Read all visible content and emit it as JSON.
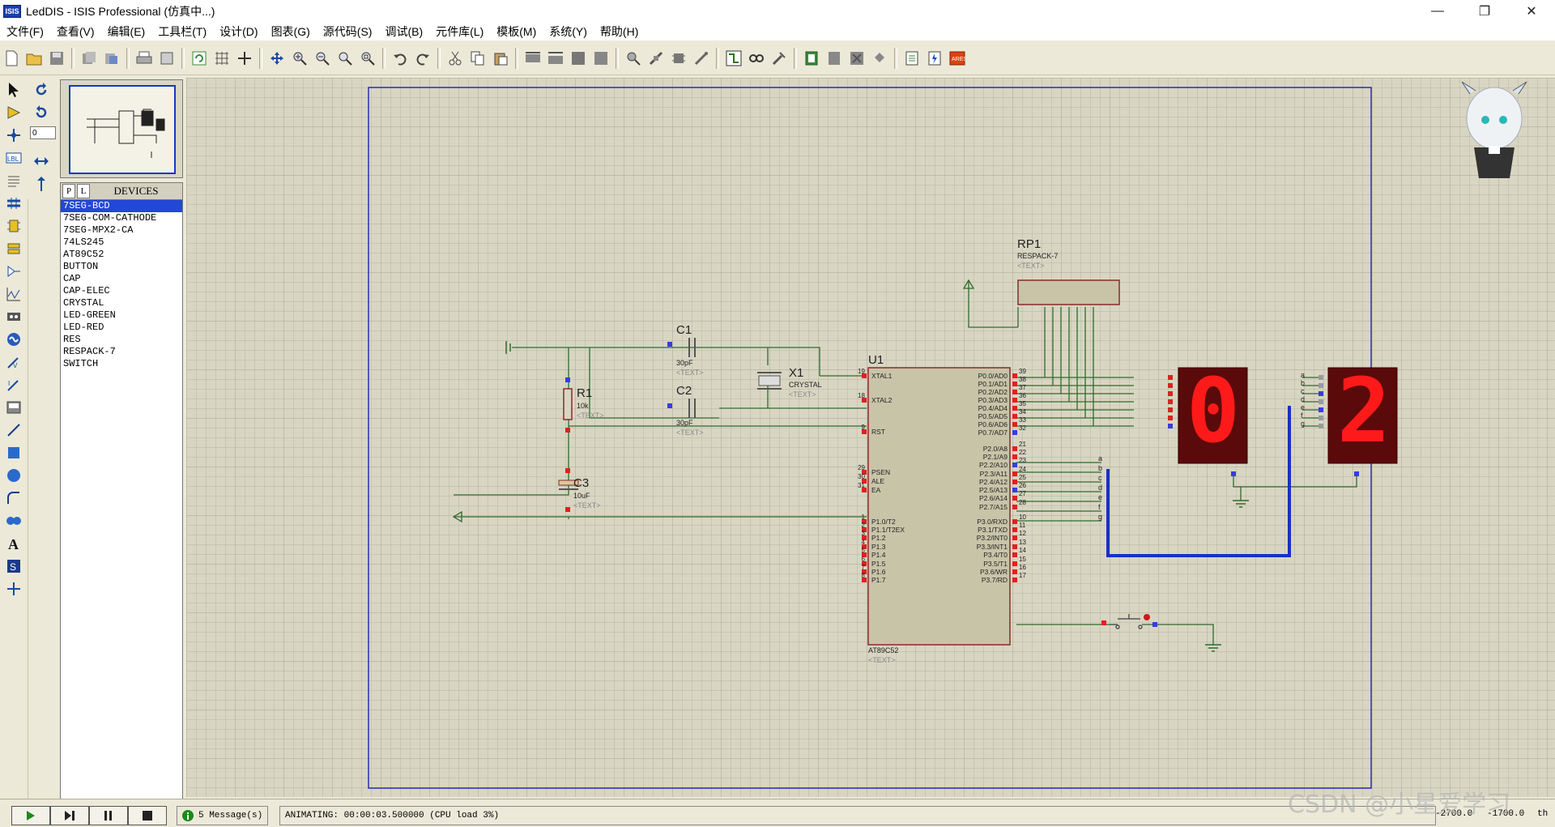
{
  "window": {
    "title": "LedDIS - ISIS Professional (仿真中...)",
    "app_icon": "ISIS"
  },
  "menu": [
    {
      "label": "文件(F)"
    },
    {
      "label": "查看(V)"
    },
    {
      "label": "编辑(E)"
    },
    {
      "label": "工具栏(T)"
    },
    {
      "label": "设计(D)"
    },
    {
      "label": "图表(G)"
    },
    {
      "label": "源代码(S)"
    },
    {
      "label": "调试(B)"
    },
    {
      "label": "元件库(L)"
    },
    {
      "label": "模板(M)"
    },
    {
      "label": "系统(Y)"
    },
    {
      "label": "帮助(H)"
    }
  ],
  "rotation_field": {
    "value": "0"
  },
  "devices": {
    "tab_p": "P",
    "tab_l": "L",
    "header": "DEVICES",
    "items": [
      {
        "label": "7SEG-BCD",
        "selected": true
      },
      {
        "label": "7SEG-COM-CATHODE"
      },
      {
        "label": "7SEG-MPX2-CA"
      },
      {
        "label": "74LS245"
      },
      {
        "label": "AT89C52"
      },
      {
        "label": "BUTTON"
      },
      {
        "label": "CAP"
      },
      {
        "label": "CAP-ELEC"
      },
      {
        "label": "CRYSTAL"
      },
      {
        "label": "LED-GREEN"
      },
      {
        "label": "LED-RED"
      },
      {
        "label": "RES"
      },
      {
        "label": "RESPACK-7"
      },
      {
        "label": "SWITCH"
      }
    ]
  },
  "schematic": {
    "rp1": {
      "ref": "RP1",
      "part": "RESPACK-7",
      "text": "<TEXT>"
    },
    "c1": {
      "ref": "C1",
      "value": "30pF",
      "text": "<TEXT>"
    },
    "c2": {
      "ref": "C2",
      "value": "30pF",
      "text": "<TEXT>"
    },
    "x1": {
      "ref": "X1",
      "part": "CRYSTAL",
      "text": "<TEXT>"
    },
    "r1": {
      "ref": "R1",
      "value": "10k",
      "text": "<TEXT>"
    },
    "c3": {
      "ref": "C3",
      "value": "10uF",
      "text": "<TEXT>"
    },
    "u1": {
      "ref": "U1",
      "part": "AT89C52",
      "text": "<TEXT>",
      "left_pins": [
        {
          "num": "19",
          "name": "XTAL1"
        },
        {
          "num": "18",
          "name": "XTAL2"
        },
        {
          "num": "9",
          "name": "RST"
        },
        {
          "num": "29",
          "name": "PSEN"
        },
        {
          "num": "30",
          "name": "ALE"
        },
        {
          "num": "31",
          "name": "EA"
        },
        {
          "num": "1",
          "name": "P1.0/T2"
        },
        {
          "num": "2",
          "name": "P1.1/T2EX"
        },
        {
          "num": "3",
          "name": "P1.2"
        },
        {
          "num": "4",
          "name": "P1.3"
        },
        {
          "num": "5",
          "name": "P1.4"
        },
        {
          "num": "6",
          "name": "P1.5"
        },
        {
          "num": "7",
          "name": "P1.6"
        },
        {
          "num": "8",
          "name": "P1.7"
        }
      ],
      "right_pins": [
        {
          "num": "39",
          "name": "P0.0/AD0"
        },
        {
          "num": "38",
          "name": "P0.1/AD1"
        },
        {
          "num": "37",
          "name": "P0.2/AD2"
        },
        {
          "num": "36",
          "name": "P0.3/AD3"
        },
        {
          "num": "35",
          "name": "P0.4/AD4"
        },
        {
          "num": "34",
          "name": "P0.5/AD5"
        },
        {
          "num": "33",
          "name": "P0.6/AD6"
        },
        {
          "num": "32",
          "name": "P0.7/AD7"
        },
        {
          "num": "21",
          "name": "P2.0/A8"
        },
        {
          "num": "22",
          "name": "P2.1/A9"
        },
        {
          "num": "23",
          "name": "P2.2/A10"
        },
        {
          "num": "24",
          "name": "P2.3/A11"
        },
        {
          "num": "25",
          "name": "P2.4/A12"
        },
        {
          "num": "26",
          "name": "P2.5/A13"
        },
        {
          "num": "27",
          "name": "P2.6/A14"
        },
        {
          "num": "28",
          "name": "P2.7/A15"
        },
        {
          "num": "10",
          "name": "P3.0/RXD"
        },
        {
          "num": "11",
          "name": "P3.1/TXD"
        },
        {
          "num": "12",
          "name": "P3.2/INT0"
        },
        {
          "num": "13",
          "name": "P3.3/INT1"
        },
        {
          "num": "14",
          "name": "P3.4/T0"
        },
        {
          "num": "15",
          "name": "P3.5/T1"
        },
        {
          "num": "16",
          "name": "P3.6/WR"
        },
        {
          "num": "17",
          "name": "P3.7/RD"
        }
      ]
    },
    "bus_labels": [
      "a",
      "b",
      "c",
      "d",
      "e",
      "f",
      "g"
    ],
    "display1_digit": "0",
    "display2_digit": "2",
    "seg_color": "#ff1a1a",
    "wire_color": "#2e6b2e",
    "bus_color": "#1a2fc8"
  },
  "status": {
    "messages": "5 Message(s)",
    "animating": "ANIMATING: 00:00:03.500000 (CPU load 3%)",
    "coord_x": "-2700.0",
    "coord_y": "-1700.0",
    "unit": "th"
  },
  "watermark": "CSDN @小星爱学习"
}
